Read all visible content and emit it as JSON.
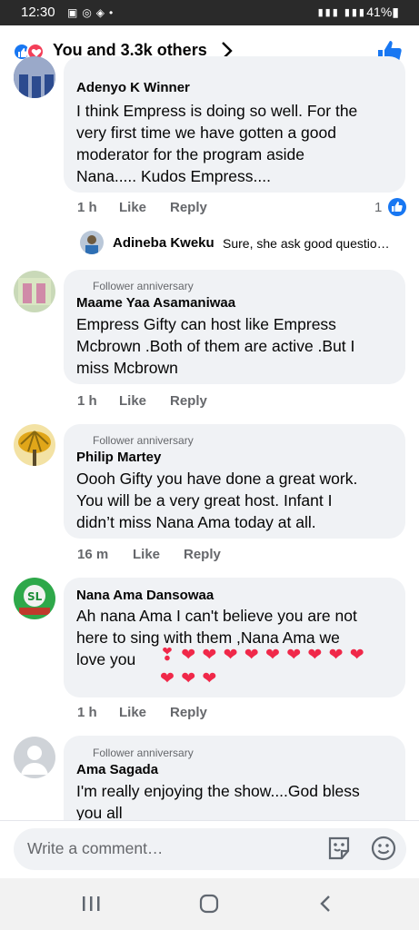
{
  "status_bar": {
    "time": "12:30",
    "battery": "41%"
  },
  "header": {
    "title": "You and 3.3k others"
  },
  "comments": [
    {
      "author": "Adenyo K Winner",
      "text": [
        "I think Empress is doing so well. For the",
        "very first time we have gotten  a good",
        "moderator for the program aside",
        "Nana..... Kudos Empress...."
      ],
      "time": "1 h",
      "like": "Like",
      "reply": "Reply",
      "reaction_count": "1"
    },
    {
      "author": "Adineba Kweku",
      "text": "Sure, she ask good questio…"
    },
    {
      "badge": "Follower anniversary",
      "author": "Maame Yaa Asamaniwaa",
      "text": [
        "Empress Gifty can host like Empress",
        "Mcbrown .Both of them are active .But I",
        "miss Mcbrown"
      ],
      "time": "1 h",
      "like": "Like",
      "reply": "Reply"
    },
    {
      "badge": "Follower anniversary",
      "author": "Philip Martey",
      "text": [
        "Oooh Gifty you have done a great work.",
        "You will be a very great host. Infant I",
        "didn’t miss Nana Ama today at all."
      ],
      "time": "16 m",
      "like": "Like",
      "reply": "Reply"
    },
    {
      "author": "Nana Ama Dansowaa",
      "text": [
        "Ah nana Ama I can't believe you are not",
        "here to sing with them ,Nana Ama we",
        "love you"
      ],
      "emoji": "❣ ❤ ❤ ❤ ❤ ❤ ❤ ❤ ❤ ❤ ❤ ❤ ❤",
      "time": "1 h",
      "like": "Like",
      "reply": "Reply"
    },
    {
      "badge": "Follower anniversary",
      "author": "Ama Sagada",
      "text": [
        "I'm really enjoying the show....God bless",
        "you all"
      ]
    }
  ],
  "composer": {
    "placeholder": "Write a comment…"
  },
  "colors": {
    "facebook_blue": "#1877f2",
    "bubble_grey": "#f0f2f5",
    "heart_red": "#f02849"
  }
}
